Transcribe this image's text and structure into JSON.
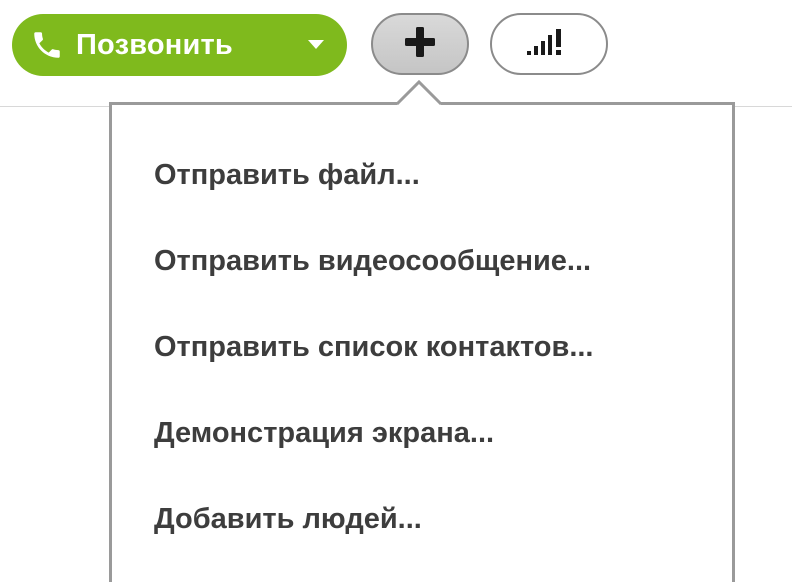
{
  "toolbar": {
    "call_button": {
      "label": "Позвонить",
      "icon": "phone-icon",
      "dropdown_icon": "chevron-down-icon",
      "color": "#7fba1d"
    },
    "add_button": {
      "icon": "plus-icon"
    },
    "quality_button": {
      "icon": "signal-strength-icon"
    }
  },
  "menu": {
    "items": [
      {
        "label": "Отправить файл..."
      },
      {
        "label": "Отправить видеосообщение..."
      },
      {
        "label": "Отправить список контактов..."
      },
      {
        "label": "Демонстрация экрана..."
      },
      {
        "label": "Добавить людей..."
      }
    ]
  }
}
